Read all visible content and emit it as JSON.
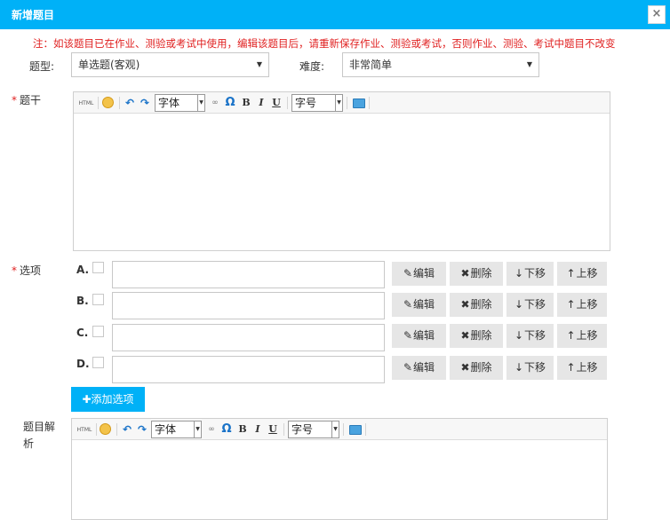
{
  "dialog": {
    "title": "新增题目",
    "close_icon": "×"
  },
  "notice": "注：如该题目已在作业、测验或考试中使用，编辑该题目后，请重新保存作业、测验或考试，否则作业、测验、考试中题目不改变",
  "form": {
    "type_label": "题型:",
    "type_value": "单选题(客观)",
    "difficulty_label": "难度:",
    "difficulty_value": "非常简单",
    "stem_label": "题干",
    "options_label": "选项",
    "analysis_label_line1": "题目解",
    "analysis_label_line2": "析",
    "required_mark": "*"
  },
  "editor_toolbar": {
    "html": "HTML",
    "font": "字体",
    "size": "字号",
    "bold": "B",
    "italic": "I",
    "underline": "U",
    "omega": "Ω"
  },
  "options": [
    {
      "letter": "A.",
      "value": ""
    },
    {
      "letter": "B.",
      "value": ""
    },
    {
      "letter": "C.",
      "value": ""
    },
    {
      "letter": "D.",
      "value": ""
    }
  ],
  "option_actions": {
    "edit": "编辑",
    "delete": "删除",
    "move_down": "下移",
    "move_up": "上移"
  },
  "add_option_label": "添加选项",
  "colors": {
    "accent": "#00b1f7",
    "warning": "#e02020",
    "button_gray": "#e6e6e6"
  }
}
